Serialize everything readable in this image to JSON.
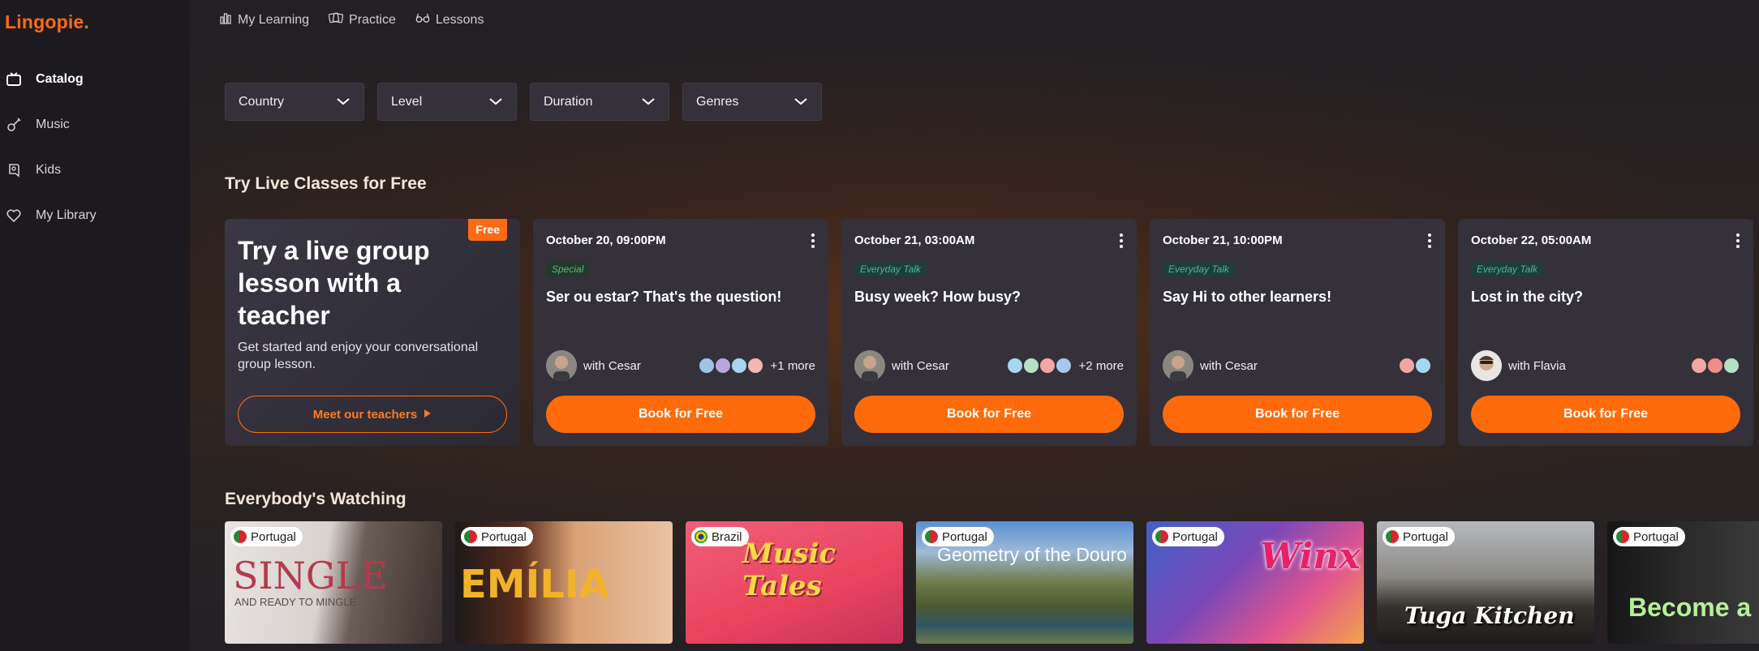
{
  "app": {
    "logo": "Lingopie."
  },
  "sidebar": {
    "items": [
      {
        "label": "Catalog",
        "icon": "tv-icon",
        "active": true
      },
      {
        "label": "Music",
        "icon": "guitar-icon"
      },
      {
        "label": "Kids",
        "icon": "kids-icon"
      },
      {
        "label": "My Library",
        "icon": "heart-icon"
      }
    ]
  },
  "topnav": {
    "items": [
      {
        "label": "My Learning",
        "icon": "bar-chart-icon"
      },
      {
        "label": "Practice",
        "icon": "cards-icon"
      },
      {
        "label": "Lessons",
        "icon": "glasses-icon"
      }
    ]
  },
  "filters": [
    "Country",
    "Level",
    "Duration",
    "Genres"
  ],
  "live_classes": {
    "title": "Try Live Classes for Free",
    "promo": {
      "badge": "Free",
      "headline": "Try a live group lesson with a teacher",
      "subtitle": "Get started and enjoy your conversational group lesson.",
      "cta": "Meet our teachers"
    },
    "cards": [
      {
        "date": "October 20, 09:00PM",
        "tag": "Special",
        "title": "Ser ou estar? That's the question!",
        "teacher": "with Cesar",
        "learners_more": "+1 more",
        "cta": "Book for Free"
      },
      {
        "date": "October 21, 03:00AM",
        "tag": "Everyday Talk",
        "title": "Busy week? How busy?",
        "teacher": "with Cesar",
        "learners_more": "+2 more",
        "cta": "Book for Free"
      },
      {
        "date": "October 21, 10:00PM",
        "tag": "Everyday Talk",
        "title": "Say Hi to other learners!",
        "teacher": "with Cesar",
        "learners_more": "",
        "cta": "Book for Free"
      },
      {
        "date": "October 22, 05:00AM",
        "tag": "Everyday Talk",
        "title": "Lost in the city?",
        "teacher": "with Flavia",
        "learners_more": "",
        "cta": "Book for Free"
      }
    ]
  },
  "watching": {
    "title": "Everybody's Watching",
    "shows": [
      {
        "country": "Portugal",
        "title": "SINGLE",
        "subtitle": "AND READY TO MINGLE"
      },
      {
        "country": "Portugal",
        "title": "EMÍLIA"
      },
      {
        "country": "Brazil",
        "title": "Music Tales"
      },
      {
        "country": "Portugal",
        "title": "Geometry of the Douro"
      },
      {
        "country": "Portugal",
        "title": "Winx"
      },
      {
        "country": "Portugal",
        "title": "Tuga Kitchen"
      },
      {
        "country": "Portugal",
        "title": "Become a l"
      }
    ]
  },
  "colors": {
    "accent": "#ff6b0a",
    "background": "#1f1d22",
    "card": "#34313b"
  }
}
